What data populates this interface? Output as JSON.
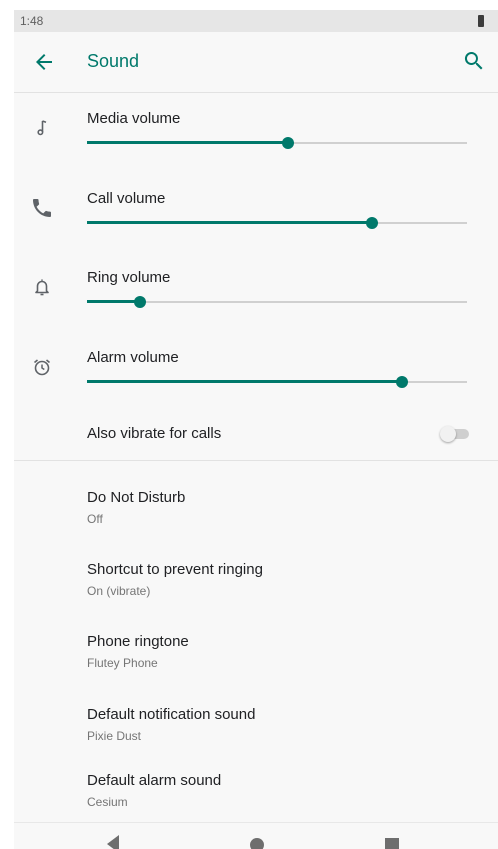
{
  "status_bar": {
    "time": "1:48"
  },
  "app_bar": {
    "title": "Sound",
    "back_icon": "arrow-left-icon",
    "search_icon": "search-icon"
  },
  "colors": {
    "accent": "#00796b",
    "background": "#f8f8f8",
    "track": "#d0d0d0",
    "text_primary": "#202124",
    "text_secondary": "#757575"
  },
  "volumes": [
    {
      "label": "Media volume",
      "icon": "music-note-icon",
      "level": 0.53
    },
    {
      "label": "Call volume",
      "icon": "phone-icon",
      "level": 0.75
    },
    {
      "label": "Ring volume",
      "icon": "bell-icon",
      "level": 0.14
    },
    {
      "label": "Alarm volume",
      "icon": "alarm-clock-icon",
      "level": 0.83
    }
  ],
  "vibrate": {
    "label": "Also vibrate for calls",
    "enabled": false
  },
  "items": [
    {
      "title": "Do Not Disturb",
      "subtitle": "Off"
    },
    {
      "title": "Shortcut to prevent ringing",
      "subtitle": "On (vibrate)"
    },
    {
      "title": "Phone ringtone",
      "subtitle": "Flutey Phone"
    },
    {
      "title": "Default notification sound",
      "subtitle": "Pixie Dust"
    },
    {
      "title": "Default alarm sound",
      "subtitle": "Cesium"
    }
  ]
}
